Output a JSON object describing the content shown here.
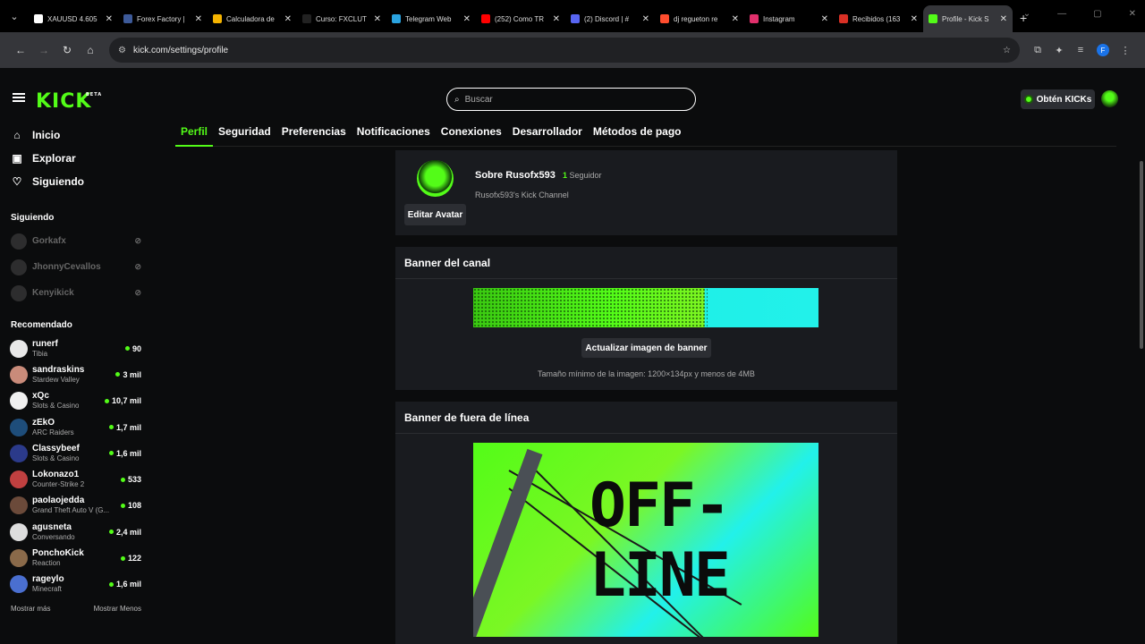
{
  "browser": {
    "tabs": [
      {
        "title": "XAUUSD 4.605",
        "color": "#ffffff",
        "active": false
      },
      {
        "title": "Forex Factory |",
        "color": "#3d5a99",
        "active": false
      },
      {
        "title": "Calculadora de",
        "color": "#f5b400",
        "active": false
      },
      {
        "title": "Curso: FXCLUT",
        "color": "#222222",
        "active": false
      },
      {
        "title": "Telegram Web",
        "color": "#2aa3e0",
        "active": false
      },
      {
        "title": "(252) Como TR",
        "color": "#ff0000",
        "active": false
      },
      {
        "title": "(2) Discord | #",
        "color": "#5865f2",
        "active": false
      },
      {
        "title": "dj regueton re",
        "color": "#ff4d2e",
        "active": false
      },
      {
        "title": "Instagram",
        "color": "#e1306c",
        "active": false
      },
      {
        "title": "Recibidos (163",
        "color": "#d93025",
        "active": false
      },
      {
        "title": "Profile - Kick S",
        "color": "#53fc18",
        "active": true
      }
    ],
    "url": "kick.com/settings/profile",
    "profile_initial": "F"
  },
  "header": {
    "logo": "KICK",
    "logo_badge": "BETA",
    "search_placeholder": "Buscar",
    "kicks_label": "Obtén KICKs"
  },
  "sidebar": {
    "nav": [
      {
        "label": "Inicio",
        "icon": "home-icon"
      },
      {
        "label": "Explorar",
        "icon": "browse-icon"
      },
      {
        "label": "Siguiendo",
        "icon": "heart-icon"
      }
    ],
    "following_title": "Siguiendo",
    "following": [
      {
        "name": "Gorkafx"
      },
      {
        "name": "JhonnyCevallos"
      },
      {
        "name": "Kenyikick"
      }
    ],
    "recommended_title": "Recomendado",
    "recommended": [
      {
        "name": "runerf",
        "category": "Tibia",
        "viewers": "90",
        "color": "#e8e8e8"
      },
      {
        "name": "sandraskins",
        "category": "Stardew Valley",
        "viewers": "3 mil",
        "color": "#c98b7a"
      },
      {
        "name": "xQc",
        "category": "Slots & Casino",
        "viewers": "10,7 mil",
        "color": "#f0f0f0"
      },
      {
        "name": "zEkO",
        "category": "ARC Raiders",
        "viewers": "1,7 mil",
        "color": "#1e4d7a"
      },
      {
        "name": "Classybeef",
        "category": "Slots & Casino",
        "viewers": "1,6 mil",
        "color": "#2b3a8a"
      },
      {
        "name": "Lokonazo1",
        "category": "Counter-Strike 2",
        "viewers": "533",
        "color": "#c04040"
      },
      {
        "name": "paolaojedda",
        "category": "Grand Theft Auto V (G...",
        "viewers": "108",
        "color": "#6b4a3a"
      },
      {
        "name": "agusneta",
        "category": "Conversando",
        "viewers": "2,4 mil",
        "color": "#dddddd"
      },
      {
        "name": "PonchoKick",
        "category": "Reaction",
        "viewers": "122",
        "color": "#8a6a4a"
      },
      {
        "name": "rageylo",
        "category": "Minecraft",
        "viewers": "1,6 mil",
        "color": "#4a6fd0"
      }
    ],
    "show_more": "Mostrar más",
    "show_less": "Mostrar Menos"
  },
  "settings_tabs": [
    "Perfil",
    "Seguridad",
    "Preferencias",
    "Notificaciones",
    "Conexiones",
    "Desarrollador",
    "Métodos de pago"
  ],
  "profile": {
    "about": "Sobre Rusofx593",
    "followers_count": "1",
    "followers_label": "Seguidor",
    "description": "Rusofx593's Kick Channel",
    "edit_avatar": "Editar Avatar"
  },
  "banner_section": {
    "title": "Banner del canal",
    "update_button": "Actualizar imagen de banner",
    "note": "Tamaño mínimo de la imagen: 1200×134px y menos de 4MB"
  },
  "offline_section": {
    "title": "Banner de fuera de línea",
    "image_text_line1": "OFF-",
    "image_text_line2": "LINE"
  },
  "colors": {
    "accent": "#53fc18",
    "card": "#191b1f",
    "background": "#0b0c0d"
  }
}
